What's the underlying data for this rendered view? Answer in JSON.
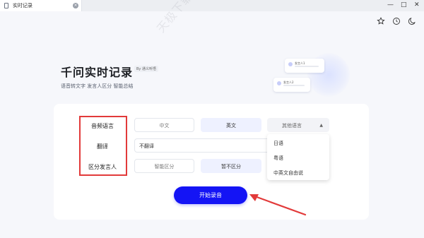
{
  "window": {
    "tab_title": "实时记录",
    "close_glyph": "×",
    "minimize_glyph": "—",
    "maximize_glyph": "□",
    "window_close_glyph": "✕"
  },
  "toolbar": {
    "icons": [
      "star-icon",
      "history-icon",
      "moon-icon"
    ]
  },
  "hero": {
    "title": "千问实时记录",
    "badge": "By 通义听悟",
    "subtitle": "语音转文字 发言人区分 智能总结",
    "deco_cards": [
      {
        "name": "发言人1"
      },
      {
        "name": "发言人2"
      }
    ]
  },
  "settings": {
    "labels": {
      "audio_language": "音频语言",
      "translation": "翻译",
      "speaker": "区分发言人"
    },
    "language_options": [
      "中文",
      "英文",
      "其他语言"
    ],
    "language_selected": "英文",
    "translation_value": "不翻译",
    "speaker_options": [
      "智能区分",
      "暂不区分"
    ],
    "speaker_selected": "暂不区分"
  },
  "dropdown_menu": {
    "items": [
      "日语",
      "粤语",
      "中英文自由说"
    ]
  },
  "start_button": "开始录音",
  "watermark": "天极下载站 mydown.yesky.com",
  "colors": {
    "accent": "#1414f5",
    "selected_bg": "#eef1ff",
    "annotation_red": "#e23a3a"
  }
}
